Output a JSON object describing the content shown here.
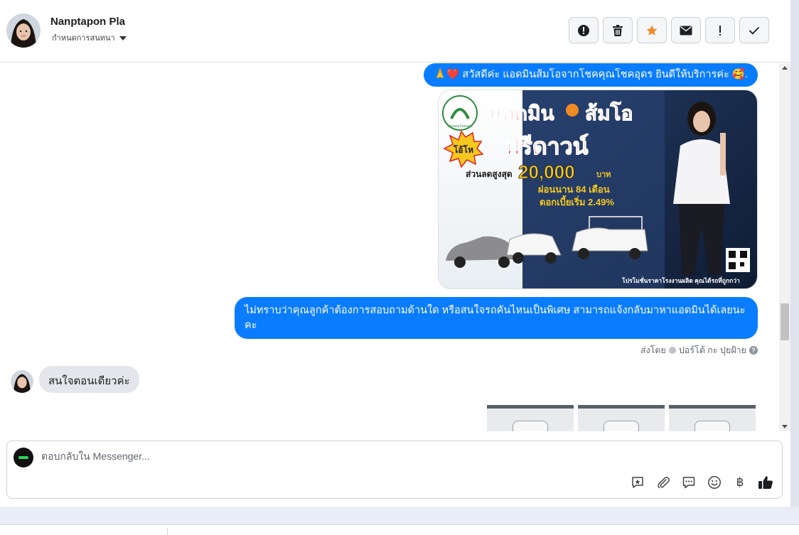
{
  "header": {
    "contact_name": "Nanptapon Pla",
    "assign_label": "กำหนดการสนทนา",
    "actions": [
      {
        "name": "spam",
        "icon": "exclamation-circle-icon"
      },
      {
        "name": "delete",
        "icon": "trash-icon"
      },
      {
        "name": "star",
        "icon": "star-icon",
        "color": "#f08a24"
      },
      {
        "name": "mark-unread",
        "icon": "envelope-icon"
      },
      {
        "name": "follow-up",
        "icon": "exclamation-icon"
      },
      {
        "name": "done",
        "icon": "check-icon"
      }
    ]
  },
  "messages": {
    "greeting": "🙏❤️ สวัสดีค่ะ แอดมินส้มโอจากโชคคุณโชคอุดร ยินดีให้บริการค่ะ 🥰.",
    "promo": {
      "brand": "โชคคุณโชคอุดร",
      "title_line1": "แอดมิน",
      "title_line2": "ส้มโอ",
      "badge": "โอ้โห",
      "headline": "ฟรีดาวน์",
      "discount_label": "ส่วนลดสูงสุด",
      "discount_amount": "20,000",
      "currency": "บาท",
      "installment": "ผ่อนนาน 84 เดือน",
      "interest": "ดอกเบี้ยเริ่ม 2.49%",
      "footer": "โปรโมชั่นราคาโรงงานผลิต คุณได้รถที่ถูกกว่า"
    },
    "question": "ไม่ทราบว่าคุณลูกค้าต้องการสอบถามด้านใด หรือสนใจรถคันไหนเป็นพิเศษ สามารถแจ้งกลับมาหาแอดมินได้เลยนะคะ",
    "sent_by_prefix": "ส่งโดย",
    "sent_by_name": "ปอร์โต้ กะ ปุยฝ้าย",
    "incoming": "สนใจตอนเดียวค่ะ"
  },
  "composer": {
    "placeholder": "ตอบกลับใน Messenger...",
    "currency_symbol": "฿",
    "tools": [
      "saved-reply-icon",
      "attachment-icon",
      "chat-bubble-icon",
      "emoji-icon",
      "baht-icon",
      "thumbs-up-icon"
    ]
  },
  "colors": {
    "accent": "#0a7cff",
    "incoming_bubble": "#e4e6eb",
    "star": "#f08a24"
  }
}
